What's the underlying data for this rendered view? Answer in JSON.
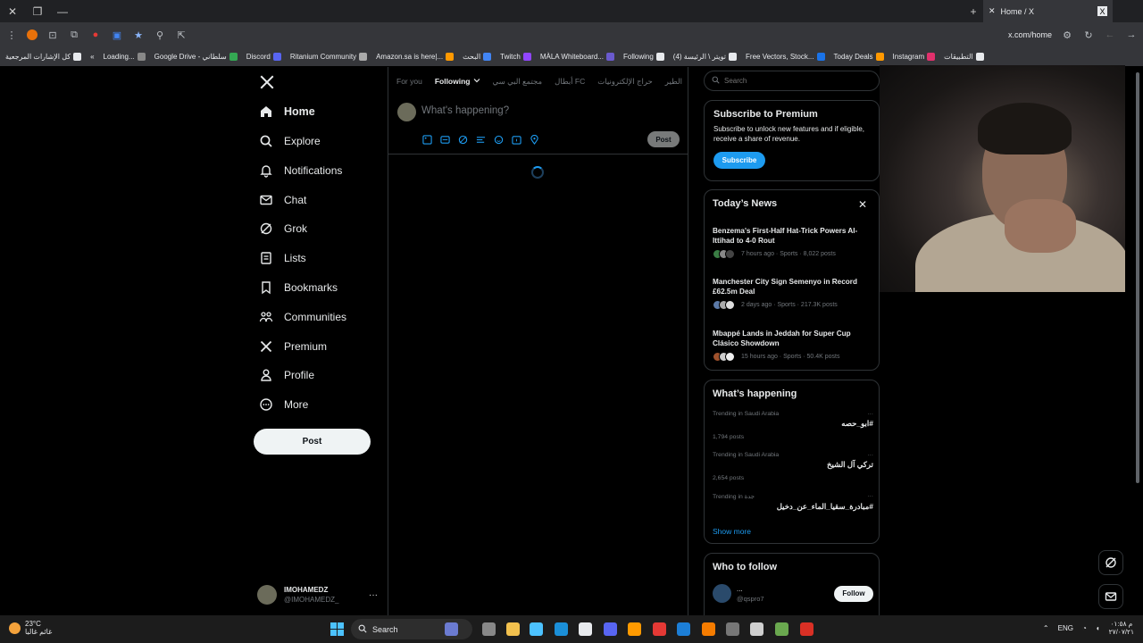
{
  "browser": {
    "tab_title": "Home / X",
    "url": "x.com/home",
    "bookmarks": [
      {
        "label": "كل الإشارات المرجعية",
        "color": "#e8eaed"
      },
      {
        "label": "Loading...",
        "color": "#888"
      },
      {
        "label": "Google Drive - سلطاني",
        "color": "#34a853"
      },
      {
        "label": "Discord",
        "color": "#5865f2"
      },
      {
        "label": "Ritanium Community",
        "color": "#aaa"
      },
      {
        "label": "Amazon.sa is here|...",
        "color": "#ff9900"
      },
      {
        "label": "البحث",
        "color": "#4285f4"
      },
      {
        "label": "Twitch",
        "color": "#9146ff"
      },
      {
        "label": "MÀLA Whiteboard...",
        "color": "#6a5acd"
      },
      {
        "label": "Following",
        "color": "#e8eaed"
      },
      {
        "label": "(4) تويتر \\ الرئيسة",
        "color": "#e8eaed"
      },
      {
        "label": "Free Vectors, Stock...",
        "color": "#1a73e8"
      },
      {
        "label": "Today Deals",
        "color": "#ff9900"
      },
      {
        "label": "Instagram",
        "color": "#e1306c"
      },
      {
        "label": "التطبيقات",
        "color": "#e8eaed"
      }
    ]
  },
  "nav": {
    "items": [
      {
        "label": "Home",
        "icon": "home-icon"
      },
      {
        "label": "Explore",
        "icon": "search-icon"
      },
      {
        "label": "Notifications",
        "icon": "bell-icon"
      },
      {
        "label": "Chat",
        "icon": "mail-icon"
      },
      {
        "label": "Grok",
        "icon": "grok-icon"
      },
      {
        "label": "Lists",
        "icon": "list-icon"
      },
      {
        "label": "Bookmarks",
        "icon": "bookmark-icon"
      },
      {
        "label": "Communities",
        "icon": "people-icon"
      },
      {
        "label": "Premium",
        "icon": "x-icon"
      },
      {
        "label": "Profile",
        "icon": "person-icon"
      },
      {
        "label": "More",
        "icon": "more-icon"
      }
    ],
    "post_label": "Post"
  },
  "account": {
    "name": "IMOHAMEDZ",
    "handle": "@IMOHAMEDZ_",
    "more": "···"
  },
  "tabs": [
    "For you",
    "Following",
    "مجتمع البي سي",
    "أبطال FC",
    "حراج الإلكترونيات",
    "الطير"
  ],
  "composer": {
    "placeholder": "What's happening?",
    "post_label": "Post"
  },
  "search": {
    "placeholder": "Search"
  },
  "premium": {
    "title": "Subscribe to Premium",
    "body": "Subscribe to unlock new features and if eligible, receive a share of revenue.",
    "button": "Subscribe"
  },
  "news": {
    "title": "Today’s News",
    "items": [
      {
        "headline": "Benzema's First-Half Hat-Trick Powers Al-Ittihad to 4-0 Rout",
        "meta": "7 hours ago · Sports · 8,022 posts"
      },
      {
        "headline": "Manchester City Sign Semenyo in Record £62.5m Deal",
        "meta": "2 days ago · Sports · 217.3K posts"
      },
      {
        "headline": "Mbappé Lands in Jeddah for Super Cup Clásico Showdown",
        "meta": "15 hours ago · Sports · 50.4K posts"
      }
    ]
  },
  "trending": {
    "title": "What’s happening",
    "items": [
      {
        "context": "Trending in Saudi Arabia",
        "tag": "#ابو_حصه",
        "count": "1,794 posts"
      },
      {
        "context": "Trending in Saudi Arabia",
        "tag": "تركي آل الشيخ",
        "count": "2,654 posts"
      },
      {
        "context": "Trending in جدة",
        "tag": "#مبادرة_سقيا_الماء_عن_دخيل",
        "count": ""
      }
    ],
    "show_more": "Show more"
  },
  "follow": {
    "title": "Who to follow",
    "name": "...",
    "handle": "@qspro7",
    "button": "Follow"
  },
  "taskbar": {
    "temp": "23°C",
    "weather_text": "غائم غالبا",
    "search": "Search",
    "lang": "ENG",
    "time": "م ٠١:٥٨",
    "date": "٢٧/٠٧/٢١"
  }
}
